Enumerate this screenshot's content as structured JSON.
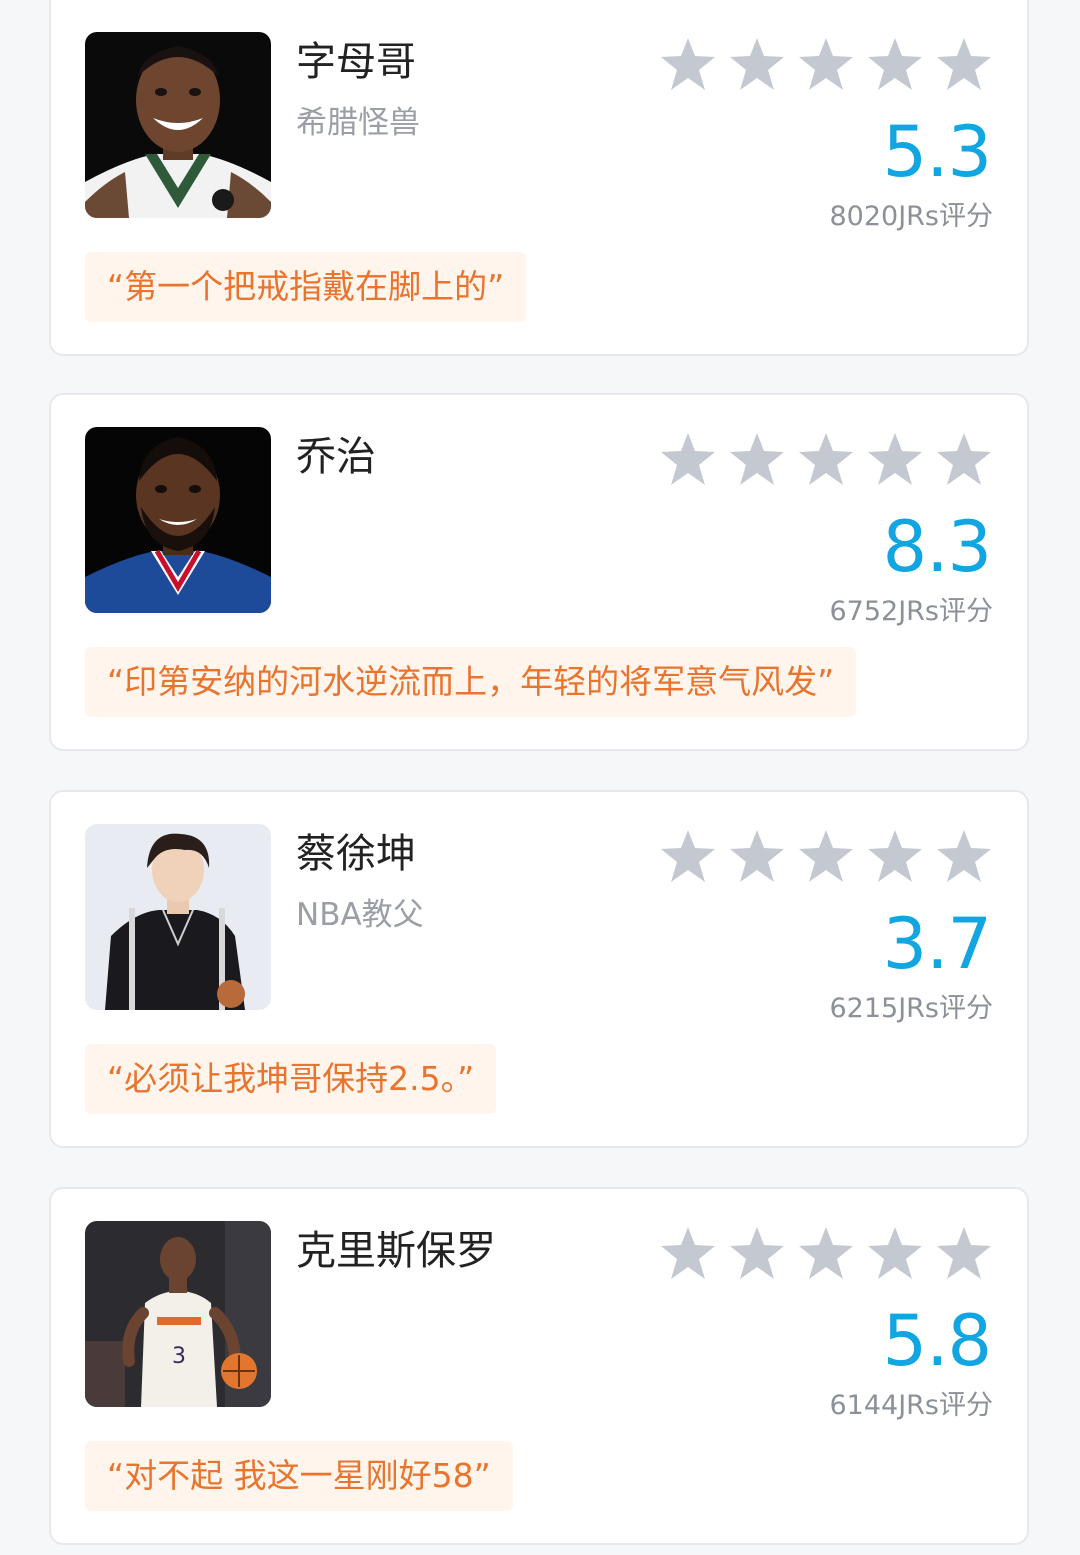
{
  "colors": {
    "score": "#11a6e2",
    "quote_text": "#e8742d",
    "quote_bg": "#fff5ec",
    "star": "#c4c8d0"
  },
  "cards": [
    {
      "name": "字母哥",
      "subtitle": "希腊怪兽",
      "score": "5.3",
      "count": "8020JRs评分",
      "quote": "“第一个把戒指戴在脚上的”",
      "photo_icon": "player-photo"
    },
    {
      "name": "乔治",
      "subtitle": "",
      "score": "8.3",
      "count": "6752JRs评分",
      "quote": "“印第安纳的河水逆流而上，年轻的将军意气风发”",
      "photo_icon": "player-photo"
    },
    {
      "name": "蔡徐坤",
      "subtitle": "NBA教父",
      "score": "3.7",
      "count": "6215JRs评分",
      "quote": "“必须让我坤哥保持2.5。”",
      "photo_icon": "person-photo"
    },
    {
      "name": "克里斯保罗",
      "subtitle": "",
      "score": "5.8",
      "count": "6144JRs评分",
      "quote": "“对不起 我这一星刚好58”",
      "photo_icon": "player-photo"
    }
  ]
}
